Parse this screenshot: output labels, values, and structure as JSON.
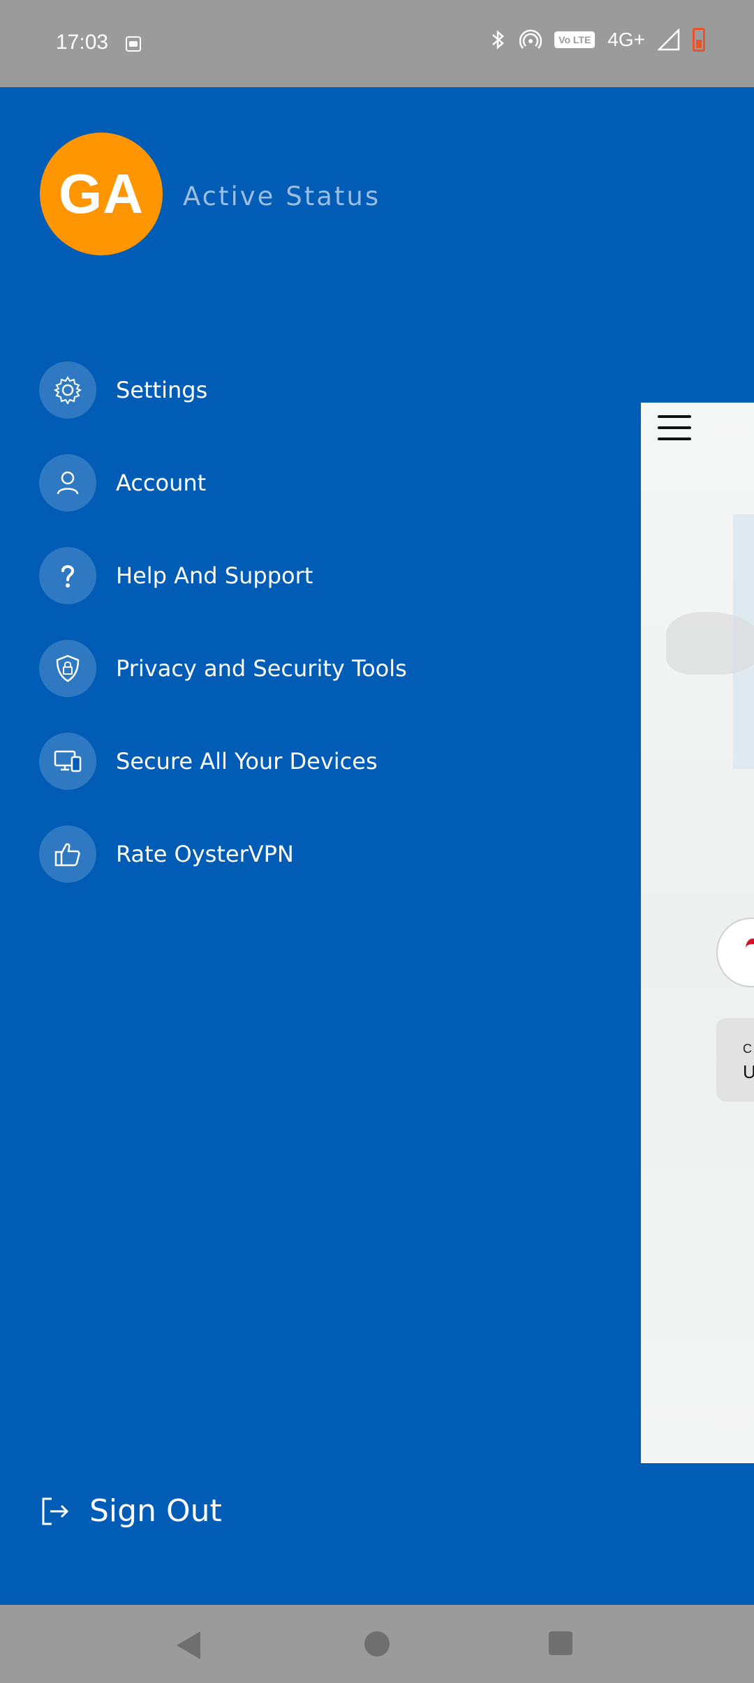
{
  "status_bar": {
    "time": "17:03",
    "network": "4G+",
    "volte": "Vo LTE"
  },
  "profile": {
    "initials": "GA",
    "status_text": "Active Status",
    "avatar_color": "#ff9500"
  },
  "drawer": {
    "background": "#015cb5",
    "items": [
      {
        "label": "Settings",
        "icon": "gear-icon"
      },
      {
        "label": "Account",
        "icon": "user-icon"
      },
      {
        "label": "Help And Support",
        "icon": "question-icon"
      },
      {
        "label": "Privacy and Security Tools",
        "icon": "shield-lock-icon"
      },
      {
        "label": "Secure All Your Devices",
        "icon": "devices-icon"
      },
      {
        "label": "Rate OysterVPN",
        "icon": "thumbs-up-icon"
      }
    ],
    "sign_out": {
      "label": "Sign Out",
      "icon": "sign-out-icon"
    }
  },
  "background_app": {
    "card_line1": "C",
    "card_line2": "U"
  }
}
